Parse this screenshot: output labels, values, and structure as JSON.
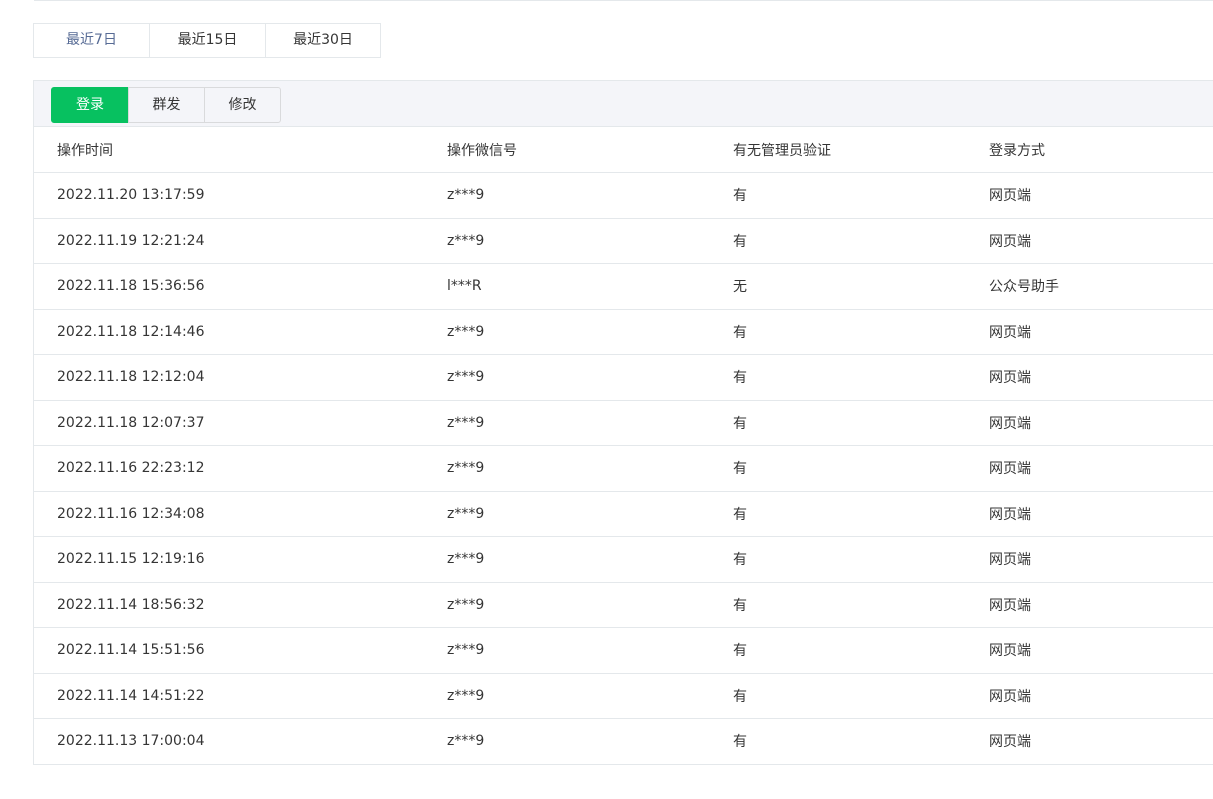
{
  "date_range": {
    "options": [
      "最近7日",
      "最近15日",
      "最近30日"
    ],
    "selected": "最近7日"
  },
  "tabs": {
    "items": [
      "登录",
      "群发",
      "修改"
    ],
    "active": "登录"
  },
  "table": {
    "columns": [
      "操作时间",
      "操作微信号",
      "有无管理员验证",
      "登录方式"
    ],
    "rows": [
      [
        "2022.11.20 13:17:59",
        "z***9",
        "有",
        "网页端"
      ],
      [
        "2022.11.19 12:21:24",
        "z***9",
        "有",
        "网页端"
      ],
      [
        "2022.11.18 15:36:56",
        "l***R",
        "无",
        "公众号助手"
      ],
      [
        "2022.11.18 12:14:46",
        "z***9",
        "有",
        "网页端"
      ],
      [
        "2022.11.18 12:12:04",
        "z***9",
        "有",
        "网页端"
      ],
      [
        "2022.11.18 12:07:37",
        "z***9",
        "有",
        "网页端"
      ],
      [
        "2022.11.16 22:23:12",
        "z***9",
        "有",
        "网页端"
      ],
      [
        "2022.11.16 12:34:08",
        "z***9",
        "有",
        "网页端"
      ],
      [
        "2022.11.15 12:19:16",
        "z***9",
        "有",
        "网页端"
      ],
      [
        "2022.11.14 18:56:32",
        "z***9",
        "有",
        "网页端"
      ],
      [
        "2022.11.14 15:51:56",
        "z***9",
        "有",
        "网页端"
      ],
      [
        "2022.11.14 14:51:22",
        "z***9",
        "有",
        "网页端"
      ],
      [
        "2022.11.13 17:00:04",
        "z***9",
        "有",
        "网页端"
      ]
    ]
  },
  "colors": {
    "accent_green": "#07c160",
    "link_blue": "#576b95",
    "border": "#e4e8eb",
    "tabbar_bg": "#f4f5f9",
    "text": "#353535"
  }
}
